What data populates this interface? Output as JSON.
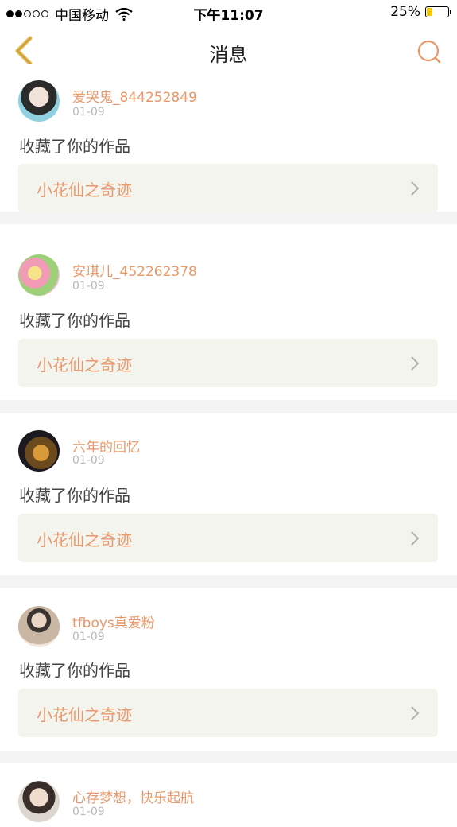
{
  "status_bar": {
    "carrier": "中国移动",
    "time": "下午11:07",
    "battery_text": "25%",
    "battery_level": 0.25,
    "signal_full_dots": 2,
    "signal_total_dots": 5
  },
  "nav": {
    "title": "消息",
    "back_icon": "chevron-left-icon",
    "search_icon": "search-icon"
  },
  "colors": {
    "accent": "#e8986a",
    "back_icon": "#e6b64d",
    "card_link_bg": "#f4f4ee",
    "separator": "#f4f4f4"
  },
  "messages": [
    {
      "username": "爱哭鬼_844252849",
      "date": "01-09",
      "action": "收藏了你的作品",
      "work_title": "小花仙之奇迹"
    },
    {
      "username": "安琪儿_452262378",
      "date": "01-09",
      "action": "收藏了你的作品",
      "work_title": "小花仙之奇迹"
    },
    {
      "username": "六年的回忆",
      "date": "01-09",
      "action": "收藏了你的作品",
      "work_title": "小花仙之奇迹"
    },
    {
      "username": "tfboys真爱粉",
      "date": "01-09",
      "action": "收藏了你的作品",
      "work_title": "小花仙之奇迹"
    },
    {
      "username": "心存梦想，快乐起航",
      "date": "01-09",
      "action": "",
      "work_title": ""
    }
  ]
}
